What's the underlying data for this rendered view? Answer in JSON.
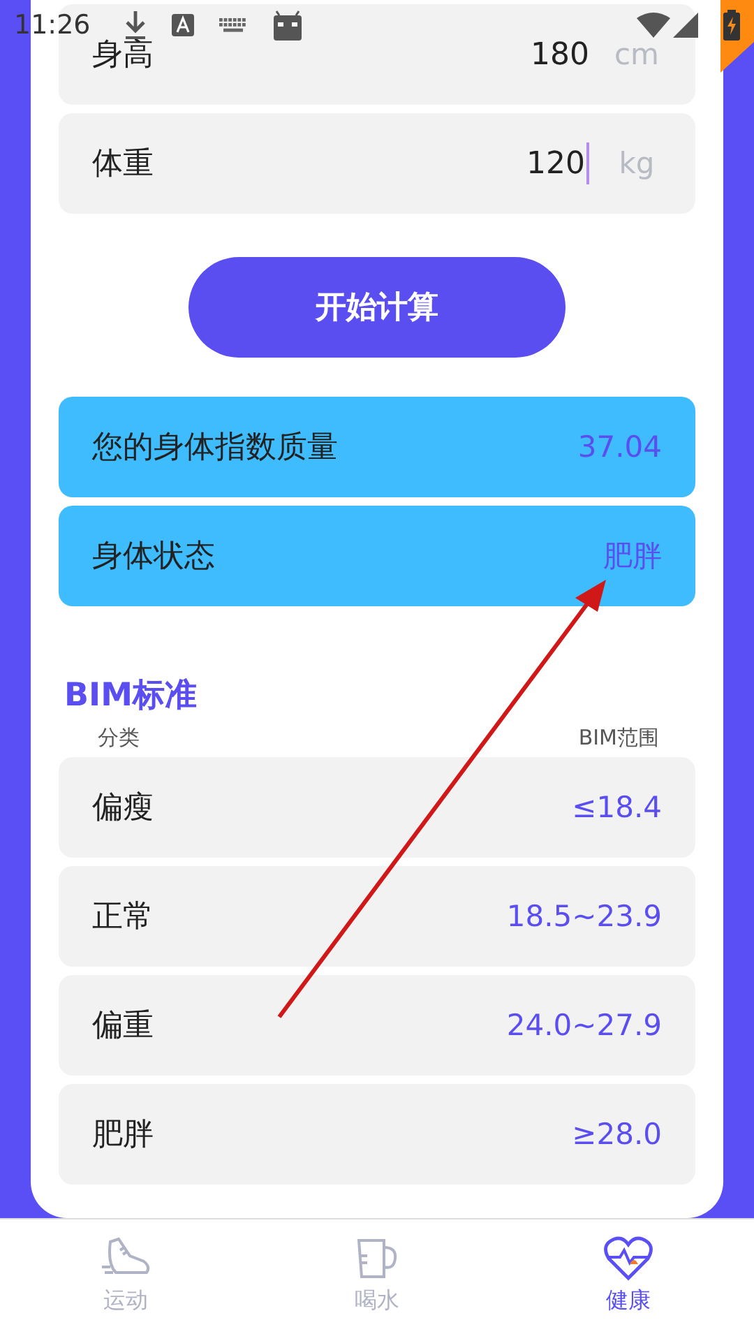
{
  "status_bar": {
    "time": "11:26"
  },
  "inputs": [
    {
      "label": "身高",
      "value": "180",
      "unit": "cm",
      "focused": false
    },
    {
      "label": "体重",
      "value": "120",
      "unit": "kg",
      "focused": true
    }
  ],
  "calculate_button": "开始计算",
  "results": [
    {
      "label": "您的身体指数质量",
      "value": "37.04"
    },
    {
      "label": "身体状态",
      "value": "肥胖"
    }
  ],
  "standard": {
    "title": "BIM标准",
    "columns": [
      "分类",
      "BIM范围"
    ],
    "rows": [
      {
        "category": "偏瘦",
        "range": "≤18.4"
      },
      {
        "category": "正常",
        "range": "18.5~23.9"
      },
      {
        "category": "偏重",
        "range": "24.0~27.9"
      },
      {
        "category": "肥胖",
        "range": "≥28.0"
      }
    ]
  },
  "tabs": [
    {
      "kind": "shoe",
      "label": "运动",
      "selected": false
    },
    {
      "kind": "cup",
      "label": "喝水",
      "selected": false
    },
    {
      "kind": "heart",
      "label": "健康",
      "selected": true
    }
  ]
}
